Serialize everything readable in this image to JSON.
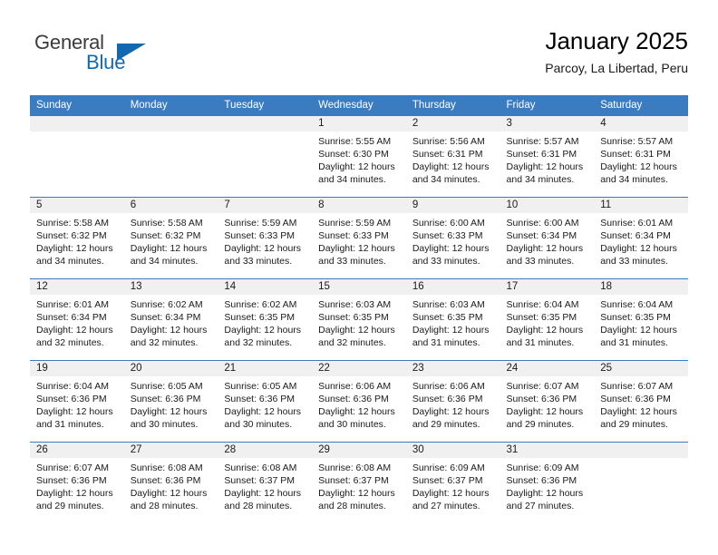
{
  "logo": {
    "word_one": "General",
    "word_two": "Blue",
    "triangle_icon": "blue-triangle-icon",
    "brand_color": "#1269b0"
  },
  "header": {
    "title": "January 2025",
    "subtitle": "Parcoy, La Libertad, Peru"
  },
  "theme": {
    "header_row_bg": "#3a7cbf",
    "daynum_bg": "#f0f0f0",
    "cell_bg": "#ffffff",
    "text_color": "#1a1a1a"
  },
  "weekday_headers": [
    "Sunday",
    "Monday",
    "Tuesday",
    "Wednesday",
    "Thursday",
    "Friday",
    "Saturday"
  ],
  "weeks": [
    [
      {
        "day": "",
        "sunrise": "",
        "sunset": "",
        "daylight_line1": "",
        "daylight_line2": ""
      },
      {
        "day": "",
        "sunrise": "",
        "sunset": "",
        "daylight_line1": "",
        "daylight_line2": ""
      },
      {
        "day": "",
        "sunrise": "",
        "sunset": "",
        "daylight_line1": "",
        "daylight_line2": ""
      },
      {
        "day": "1",
        "sunrise": "Sunrise: 5:55 AM",
        "sunset": "Sunset: 6:30 PM",
        "daylight_line1": "Daylight: 12 hours",
        "daylight_line2": "and 34 minutes."
      },
      {
        "day": "2",
        "sunrise": "Sunrise: 5:56 AM",
        "sunset": "Sunset: 6:31 PM",
        "daylight_line1": "Daylight: 12 hours",
        "daylight_line2": "and 34 minutes."
      },
      {
        "day": "3",
        "sunrise": "Sunrise: 5:57 AM",
        "sunset": "Sunset: 6:31 PM",
        "daylight_line1": "Daylight: 12 hours",
        "daylight_line2": "and 34 minutes."
      },
      {
        "day": "4",
        "sunrise": "Sunrise: 5:57 AM",
        "sunset": "Sunset: 6:31 PM",
        "daylight_line1": "Daylight: 12 hours",
        "daylight_line2": "and 34 minutes."
      }
    ],
    [
      {
        "day": "5",
        "sunrise": "Sunrise: 5:58 AM",
        "sunset": "Sunset: 6:32 PM",
        "daylight_line1": "Daylight: 12 hours",
        "daylight_line2": "and 34 minutes."
      },
      {
        "day": "6",
        "sunrise": "Sunrise: 5:58 AM",
        "sunset": "Sunset: 6:32 PM",
        "daylight_line1": "Daylight: 12 hours",
        "daylight_line2": "and 34 minutes."
      },
      {
        "day": "7",
        "sunrise": "Sunrise: 5:59 AM",
        "sunset": "Sunset: 6:33 PM",
        "daylight_line1": "Daylight: 12 hours",
        "daylight_line2": "and 33 minutes."
      },
      {
        "day": "8",
        "sunrise": "Sunrise: 5:59 AM",
        "sunset": "Sunset: 6:33 PM",
        "daylight_line1": "Daylight: 12 hours",
        "daylight_line2": "and 33 minutes."
      },
      {
        "day": "9",
        "sunrise": "Sunrise: 6:00 AM",
        "sunset": "Sunset: 6:33 PM",
        "daylight_line1": "Daylight: 12 hours",
        "daylight_line2": "and 33 minutes."
      },
      {
        "day": "10",
        "sunrise": "Sunrise: 6:00 AM",
        "sunset": "Sunset: 6:34 PM",
        "daylight_line1": "Daylight: 12 hours",
        "daylight_line2": "and 33 minutes."
      },
      {
        "day": "11",
        "sunrise": "Sunrise: 6:01 AM",
        "sunset": "Sunset: 6:34 PM",
        "daylight_line1": "Daylight: 12 hours",
        "daylight_line2": "and 33 minutes."
      }
    ],
    [
      {
        "day": "12",
        "sunrise": "Sunrise: 6:01 AM",
        "sunset": "Sunset: 6:34 PM",
        "daylight_line1": "Daylight: 12 hours",
        "daylight_line2": "and 32 minutes."
      },
      {
        "day": "13",
        "sunrise": "Sunrise: 6:02 AM",
        "sunset": "Sunset: 6:34 PM",
        "daylight_line1": "Daylight: 12 hours",
        "daylight_line2": "and 32 minutes."
      },
      {
        "day": "14",
        "sunrise": "Sunrise: 6:02 AM",
        "sunset": "Sunset: 6:35 PM",
        "daylight_line1": "Daylight: 12 hours",
        "daylight_line2": "and 32 minutes."
      },
      {
        "day": "15",
        "sunrise": "Sunrise: 6:03 AM",
        "sunset": "Sunset: 6:35 PM",
        "daylight_line1": "Daylight: 12 hours",
        "daylight_line2": "and 32 minutes."
      },
      {
        "day": "16",
        "sunrise": "Sunrise: 6:03 AM",
        "sunset": "Sunset: 6:35 PM",
        "daylight_line1": "Daylight: 12 hours",
        "daylight_line2": "and 31 minutes."
      },
      {
        "day": "17",
        "sunrise": "Sunrise: 6:04 AM",
        "sunset": "Sunset: 6:35 PM",
        "daylight_line1": "Daylight: 12 hours",
        "daylight_line2": "and 31 minutes."
      },
      {
        "day": "18",
        "sunrise": "Sunrise: 6:04 AM",
        "sunset": "Sunset: 6:35 PM",
        "daylight_line1": "Daylight: 12 hours",
        "daylight_line2": "and 31 minutes."
      }
    ],
    [
      {
        "day": "19",
        "sunrise": "Sunrise: 6:04 AM",
        "sunset": "Sunset: 6:36 PM",
        "daylight_line1": "Daylight: 12 hours",
        "daylight_line2": "and 31 minutes."
      },
      {
        "day": "20",
        "sunrise": "Sunrise: 6:05 AM",
        "sunset": "Sunset: 6:36 PM",
        "daylight_line1": "Daylight: 12 hours",
        "daylight_line2": "and 30 minutes."
      },
      {
        "day": "21",
        "sunrise": "Sunrise: 6:05 AM",
        "sunset": "Sunset: 6:36 PM",
        "daylight_line1": "Daylight: 12 hours",
        "daylight_line2": "and 30 minutes."
      },
      {
        "day": "22",
        "sunrise": "Sunrise: 6:06 AM",
        "sunset": "Sunset: 6:36 PM",
        "daylight_line1": "Daylight: 12 hours",
        "daylight_line2": "and 30 minutes."
      },
      {
        "day": "23",
        "sunrise": "Sunrise: 6:06 AM",
        "sunset": "Sunset: 6:36 PM",
        "daylight_line1": "Daylight: 12 hours",
        "daylight_line2": "and 29 minutes."
      },
      {
        "day": "24",
        "sunrise": "Sunrise: 6:07 AM",
        "sunset": "Sunset: 6:36 PM",
        "daylight_line1": "Daylight: 12 hours",
        "daylight_line2": "and 29 minutes."
      },
      {
        "day": "25",
        "sunrise": "Sunrise: 6:07 AM",
        "sunset": "Sunset: 6:36 PM",
        "daylight_line1": "Daylight: 12 hours",
        "daylight_line2": "and 29 minutes."
      }
    ],
    [
      {
        "day": "26",
        "sunrise": "Sunrise: 6:07 AM",
        "sunset": "Sunset: 6:36 PM",
        "daylight_line1": "Daylight: 12 hours",
        "daylight_line2": "and 29 minutes."
      },
      {
        "day": "27",
        "sunrise": "Sunrise: 6:08 AM",
        "sunset": "Sunset: 6:36 PM",
        "daylight_line1": "Daylight: 12 hours",
        "daylight_line2": "and 28 minutes."
      },
      {
        "day": "28",
        "sunrise": "Sunrise: 6:08 AM",
        "sunset": "Sunset: 6:37 PM",
        "daylight_line1": "Daylight: 12 hours",
        "daylight_line2": "and 28 minutes."
      },
      {
        "day": "29",
        "sunrise": "Sunrise: 6:08 AM",
        "sunset": "Sunset: 6:37 PM",
        "daylight_line1": "Daylight: 12 hours",
        "daylight_line2": "and 28 minutes."
      },
      {
        "day": "30",
        "sunrise": "Sunrise: 6:09 AM",
        "sunset": "Sunset: 6:37 PM",
        "daylight_line1": "Daylight: 12 hours",
        "daylight_line2": "and 27 minutes."
      },
      {
        "day": "31",
        "sunrise": "Sunrise: 6:09 AM",
        "sunset": "Sunset: 6:36 PM",
        "daylight_line1": "Daylight: 12 hours",
        "daylight_line2": "and 27 minutes."
      },
      {
        "day": "",
        "sunrise": "",
        "sunset": "",
        "daylight_line1": "",
        "daylight_line2": ""
      }
    ]
  ]
}
